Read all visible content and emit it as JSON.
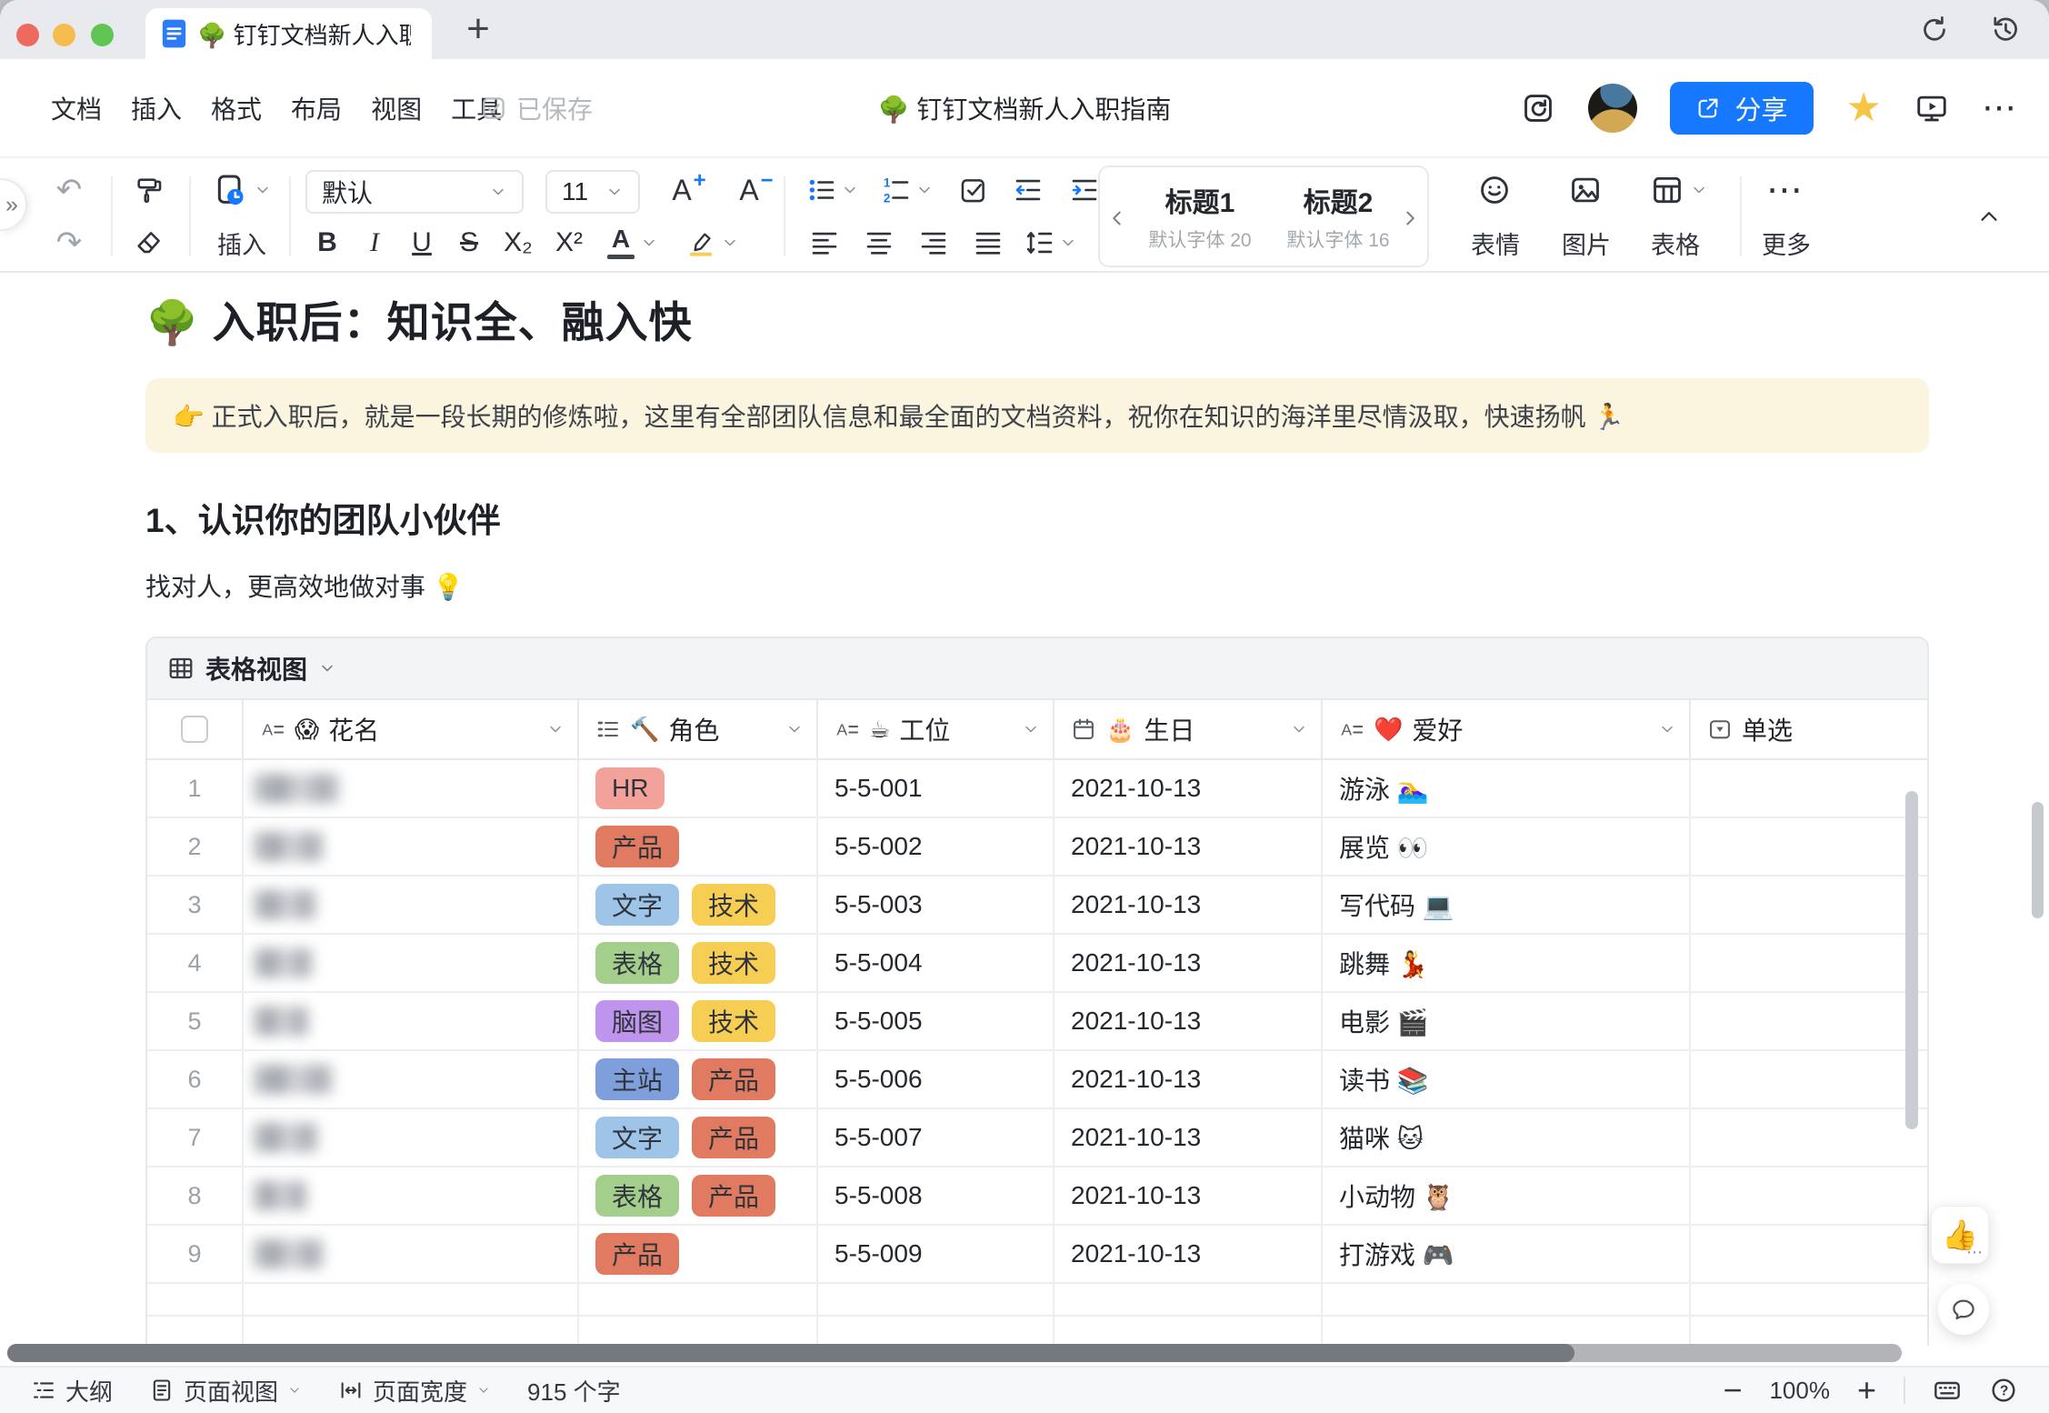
{
  "window": {
    "tab": {
      "title": "🌳 钉钉文档新人入职指"
    }
  },
  "menu_bar": {
    "items": [
      "文档",
      "插入",
      "格式",
      "布局",
      "视图",
      "工具"
    ],
    "saved_label": "已保存"
  },
  "header": {
    "doc_title": "🌳 钉钉文档新人入职指南",
    "share_label": "分享"
  },
  "toolbar": {
    "insert_label": "插入",
    "font_select": "默认",
    "size_select": "11",
    "font_letter": "A",
    "bold": "B",
    "italic": "I",
    "underline": "U",
    "strike": "S",
    "subscript": "X₂",
    "superscript": "X²",
    "font_color_letter": "A",
    "style_gallery": [
      {
        "title": "标题1",
        "meta": "默认字体 20"
      },
      {
        "title": "标题2",
        "meta": "默认字体 16"
      }
    ],
    "emoji_label": "表情",
    "image_label": "图片",
    "table_label": "表格",
    "more_label": "更多"
  },
  "document": {
    "heading1": "🌳 入职后：知识全、融入快",
    "callout": "👉 正式入职后，就是一段长期的修炼啦，这里有全部团队信息和最全面的文档资料，祝你在知识的海洋里尽情汲取，快速扬帆 🏃",
    "heading2": "1、认识你的团队小伙伴",
    "paragraph": "找对人，更高效地做对事 💡",
    "table": {
      "view_label": "表格视图",
      "columns": [
        {
          "key": "check",
          "type": "checkbox",
          "label": "",
          "emoji": "",
          "chevron": false
        },
        {
          "key": "name",
          "type": "text",
          "label": "花名",
          "emoji": "😱",
          "chevron": true
        },
        {
          "key": "role",
          "type": "multiselect",
          "label": "角色",
          "emoji": "🔨",
          "chevron": true
        },
        {
          "key": "seat",
          "type": "text",
          "label": "工位",
          "emoji": "☕",
          "chevron": true
        },
        {
          "key": "birthday",
          "type": "date",
          "label": "生日",
          "emoji": "🎂",
          "chevron": true
        },
        {
          "key": "hobby",
          "type": "text",
          "label": "爱好",
          "emoji": "❤️",
          "chevron": true
        },
        {
          "key": "select",
          "type": "select",
          "label": "单选",
          "emoji": "",
          "chevron": false
        }
      ],
      "tag_colors": {
        "HR": "#F3A29B",
        "产品": "#E07B61",
        "文字": "#9EC4E8",
        "技术": "#F7CE54",
        "表格": "#A4CE8C",
        "脑图": "#BE94EC",
        "主站": "#7E9FDB"
      },
      "names_redacted": true,
      "rows": [
        {
          "num": "1",
          "roles": [
            "HR"
          ],
          "seat": "5-5-001",
          "birthday": "2021-10-13",
          "hobby": "游泳 🏊‍♀️"
        },
        {
          "num": "2",
          "roles": [
            "产品"
          ],
          "seat": "5-5-002",
          "birthday": "2021-10-13",
          "hobby": "展览 👀"
        },
        {
          "num": "3",
          "roles": [
            "文字",
            "技术"
          ],
          "seat": "5-5-003",
          "birthday": "2021-10-13",
          "hobby": "写代码 💻"
        },
        {
          "num": "4",
          "roles": [
            "表格",
            "技术"
          ],
          "seat": "5-5-004",
          "birthday": "2021-10-13",
          "hobby": "跳舞 💃"
        },
        {
          "num": "5",
          "roles": [
            "脑图",
            "技术"
          ],
          "seat": "5-5-005",
          "birthday": "2021-10-13",
          "hobby": "电影 🎬"
        },
        {
          "num": "6",
          "roles": [
            "主站",
            "产品"
          ],
          "seat": "5-5-006",
          "birthday": "2021-10-13",
          "hobby": "读书 📚"
        },
        {
          "num": "7",
          "roles": [
            "文字",
            "产品"
          ],
          "seat": "5-5-007",
          "birthday": "2021-10-13",
          "hobby": "猫咪 🐱"
        },
        {
          "num": "8",
          "roles": [
            "表格",
            "产品"
          ],
          "seat": "5-5-008",
          "birthday": "2021-10-13",
          "hobby": "小动物 🦉"
        },
        {
          "num": "9",
          "roles": [
            "产品"
          ],
          "seat": "5-5-009",
          "birthday": "2021-10-13",
          "hobby": "打游戏 🎮"
        }
      ]
    }
  },
  "status_bar": {
    "outline": "大纲",
    "page_view": "页面视图",
    "page_width": "页面宽度",
    "word_count": "915 个字",
    "zoom": "100%"
  },
  "icons": {
    "new_tab": "+",
    "undo": "↶",
    "redo": "↷",
    "expand": "»",
    "star": "★",
    "more_dots": "⋯",
    "plus": "+",
    "minus": "−",
    "thumbs_up": "👍"
  },
  "colors": {
    "accent": "#1677FF",
    "star": "#F6C543",
    "callout_bg": "#FBF4DE"
  }
}
